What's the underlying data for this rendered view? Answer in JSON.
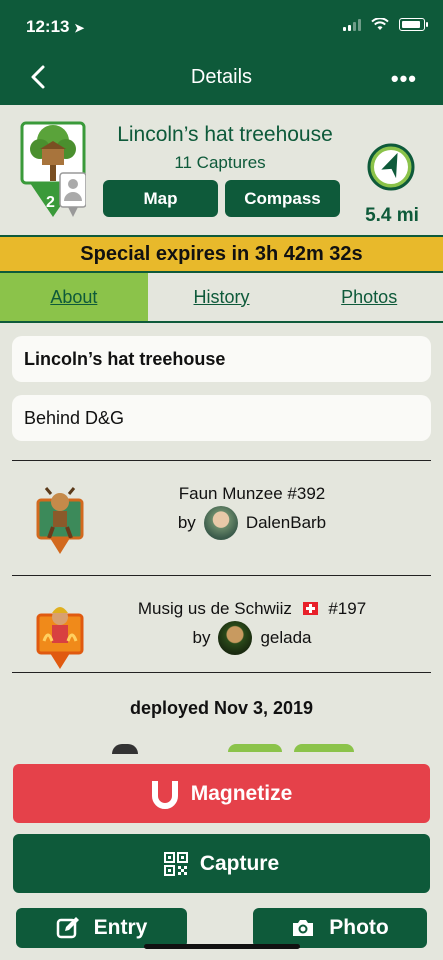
{
  "status": {
    "time": "12:13"
  },
  "nav": {
    "title": "Details"
  },
  "munzee": {
    "title": "Lincoln’s hat treehouse",
    "captures": "11 Captures",
    "badge_number": "2",
    "distance": "5.4 mi"
  },
  "buttons": {
    "map": "Map",
    "compass": "Compass",
    "magnetize": "Magnetize",
    "capture": "Capture",
    "entry": "Entry",
    "photo": "Photo"
  },
  "special": {
    "text": "Special expires in 3h 42m 32s"
  },
  "tabs": [
    {
      "label": "About",
      "active": true
    },
    {
      "label": "History",
      "active": false
    },
    {
      "label": "Photos",
      "active": false
    }
  ],
  "about": {
    "name": "Lincoln’s hat treehouse",
    "description": "Behind D&G",
    "hosts": [
      {
        "title": "Faun Munzee #392",
        "by": "by",
        "user": "DalenBarb"
      },
      {
        "title": "Musig us de Schwiiz",
        "flag": "🇨🇭",
        "number": "#197",
        "by": "by",
        "user": "gelada"
      }
    ],
    "deployed": "deployed Nov 3, 2019"
  },
  "colors": {
    "primary": "#0e5a3a",
    "accent": "#8bc34a",
    "banner": "#e8b92b",
    "danger": "#e5414a",
    "background": "#e4e6dd"
  }
}
